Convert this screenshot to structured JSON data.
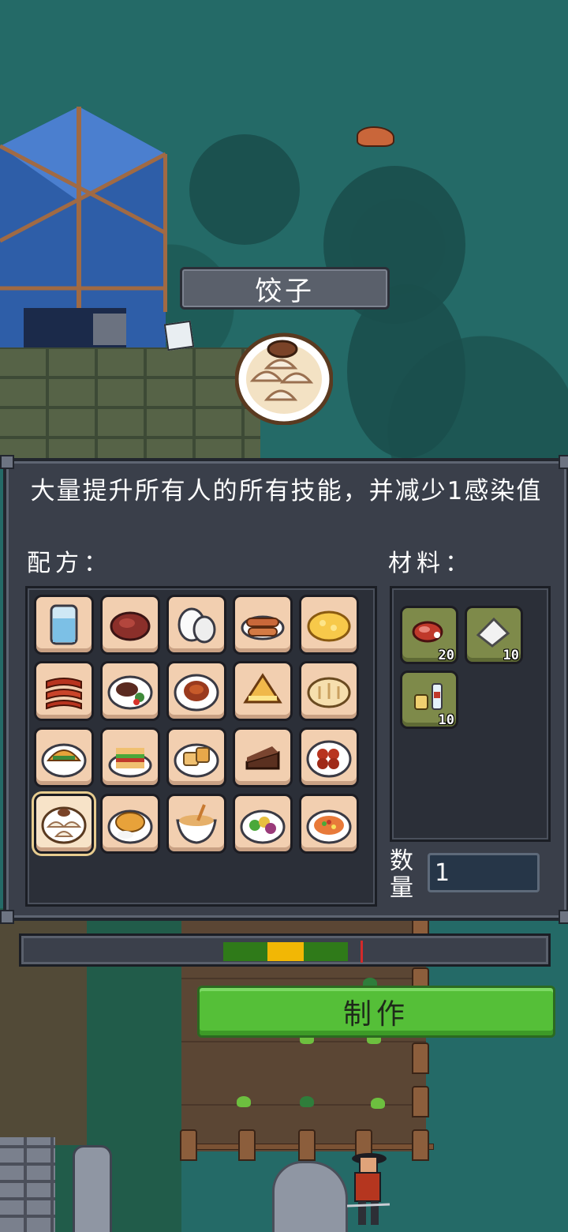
{
  "dish": {
    "name": "饺子",
    "icon": "dumplings-icon"
  },
  "panel": {
    "description": "大量提升所有人的所有技能，并减少1感染值",
    "recipe_label": "配方：",
    "materials_label": "材料：",
    "quantity_label": "数量",
    "quantity_value": "1"
  },
  "recipes": [
    {
      "icon": "water-glass-icon"
    },
    {
      "icon": "steak-icon"
    },
    {
      "icon": "boiled-eggs-icon"
    },
    {
      "icon": "grilled-sausages-icon"
    },
    {
      "icon": "scrambled-eggs-icon"
    },
    {
      "icon": "bacon-icon"
    },
    {
      "icon": "steak-plate-icon"
    },
    {
      "icon": "spaghetti-icon"
    },
    {
      "icon": "toast-sandwich-icon"
    },
    {
      "icon": "bread-loaf-icon"
    },
    {
      "icon": "taco-icon"
    },
    {
      "icon": "club-sandwich-icon"
    },
    {
      "icon": "bread-plate-icon"
    },
    {
      "icon": "chocolate-cake-icon"
    },
    {
      "icon": "meatballs-icon"
    },
    {
      "icon": "dumplings-icon",
      "selected": true
    },
    {
      "icon": "fried-chicken-rice-icon"
    },
    {
      "icon": "noodle-soup-icon"
    },
    {
      "icon": "salad-bowl-icon"
    },
    {
      "icon": "fried-rice-icon"
    }
  ],
  "materials": [
    {
      "icon": "raw-meat-icon",
      "count": "20"
    },
    {
      "icon": "flour-icon",
      "count": "10"
    },
    {
      "icon": "seasoning-icon",
      "count": "10"
    }
  ],
  "timing": {
    "colors": {
      "green": "#2f7a19",
      "yellow": "#f2b705",
      "needle": "#d22a2a"
    }
  },
  "craft_button": {
    "label": "制作",
    "color": "#55bf38"
  }
}
